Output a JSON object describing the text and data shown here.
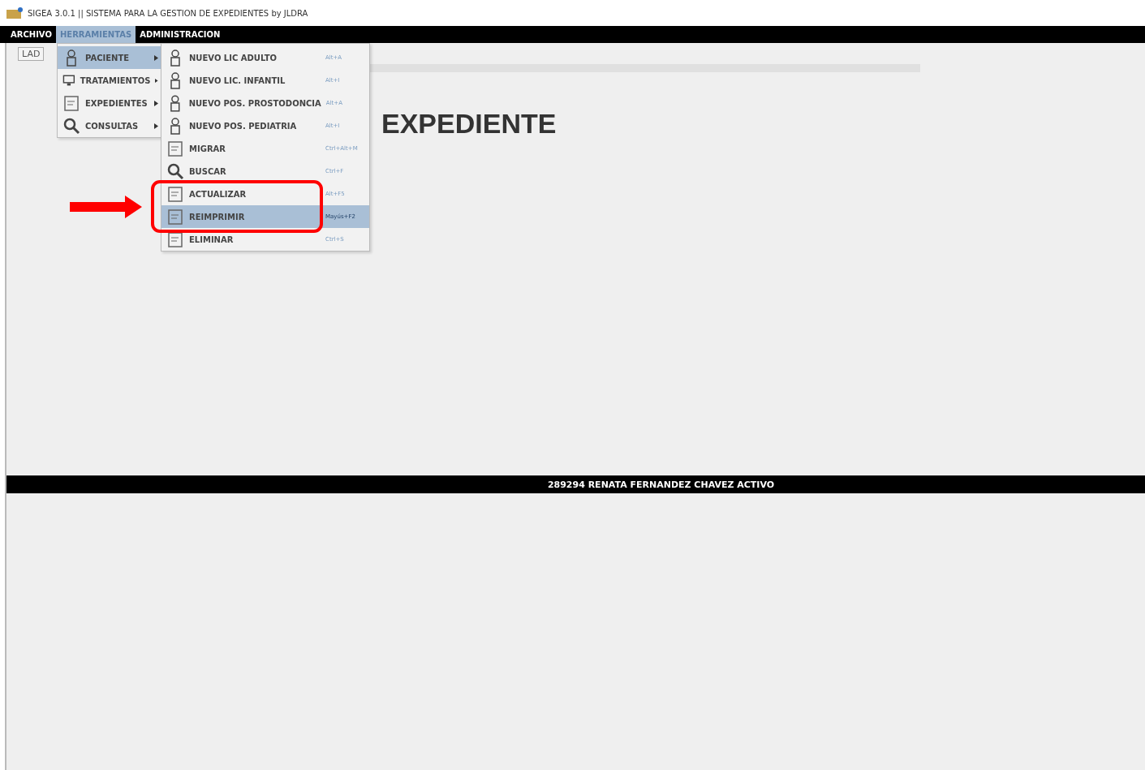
{
  "window": {
    "title": "SIGEA 3.0.1 || SISTEMA PARA LA GESTION DE EXPEDIENTES by JLDRA"
  },
  "menubar": [
    {
      "label": "ARCHIVO",
      "selected": false
    },
    {
      "label": "HERRAMIENTAS",
      "selected": true
    },
    {
      "label": "ADMINISTRACION",
      "selected": false
    }
  ],
  "toolbar": {
    "buttons": [
      "LAD"
    ]
  },
  "heading": "EXPEDIENTE",
  "menu": [
    {
      "label": "PACIENTE",
      "selected": true
    },
    {
      "label": "TRATAMIENTOS",
      "selected": false
    },
    {
      "label": "EXPEDIENTES",
      "selected": false
    },
    {
      "label": "CONSULTAS",
      "selected": false
    }
  ],
  "submenu": [
    {
      "label": "NUEVO LIC ADULTO",
      "shortcut": "Alt+A",
      "selected": false
    },
    {
      "label": "NUEVO LIC. INFANTIL",
      "shortcut": "Alt+I",
      "selected": false
    },
    {
      "label": "NUEVO POS. PROSTODONCIA",
      "shortcut": "Alt+A",
      "selected": false
    },
    {
      "label": "NUEVO POS. PEDIATRIA",
      "shortcut": "Alt+I",
      "selected": false
    },
    {
      "label": "MIGRAR",
      "shortcut": "Ctrl+Alt+M",
      "selected": false
    },
    {
      "label": "BUSCAR",
      "shortcut": "Ctrl+F",
      "selected": false
    },
    {
      "label": "ACTUALIZAR",
      "shortcut": "Alt+F5",
      "selected": false
    },
    {
      "label": "REIMPRIMIR",
      "shortcut": "Mayús+F2",
      "selected": true
    },
    {
      "label": "ELIMINAR",
      "shortcut": "Ctrl+S",
      "selected": false
    }
  ],
  "status_bar": "289294 RENATA FERNANDEZ CHAVEZ ACTIVO"
}
